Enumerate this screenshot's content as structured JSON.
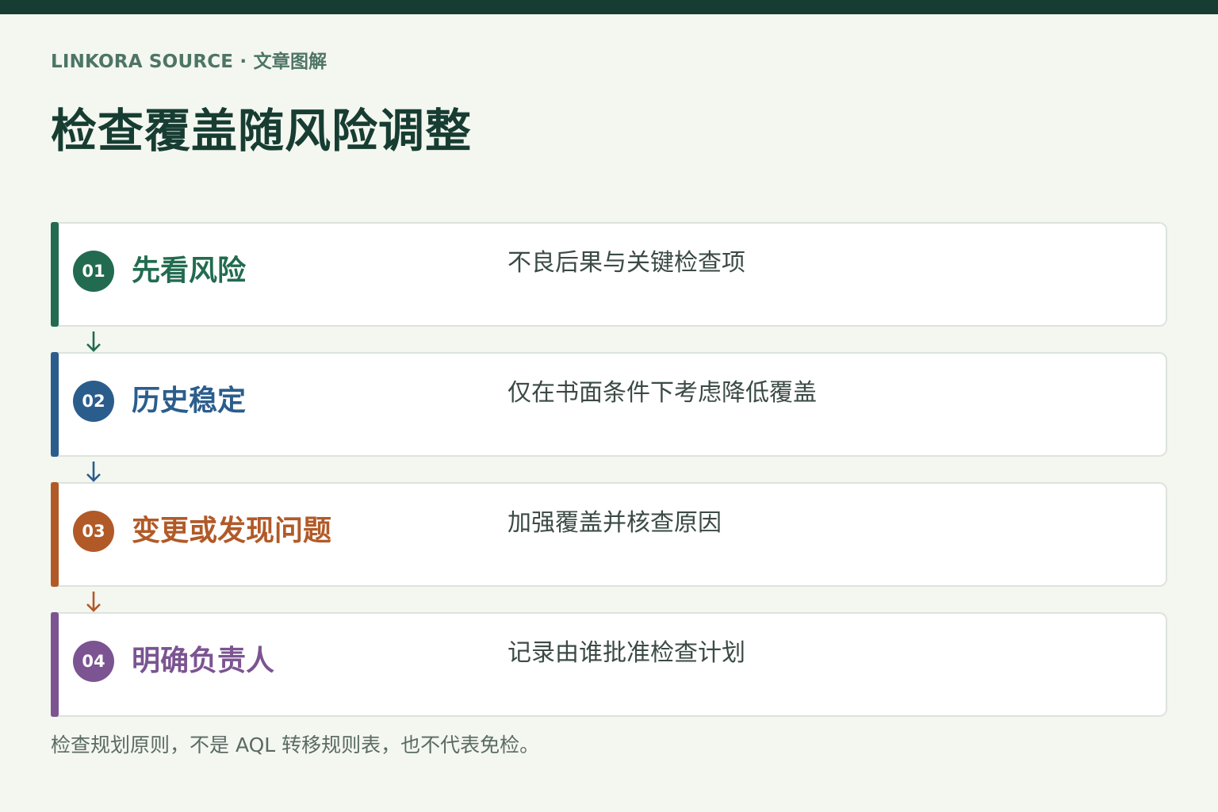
{
  "header": {
    "kicker": "LINKORA SOURCE · 文章图解",
    "title": "检查覆盖随风险调整"
  },
  "steps": [
    {
      "number": "01",
      "title": "先看风险",
      "description": "不良后果与关键检查项",
      "color": "#226b51"
    },
    {
      "number": "02",
      "title": "历史稳定",
      "description": "仅在书面条件下考虑降低覆盖",
      "color": "#2b5d8c"
    },
    {
      "number": "03",
      "title": "变更或发现问题",
      "description": "加强覆盖并核查原因",
      "color": "#b15a28"
    },
    {
      "number": "04",
      "title": "明确负责人",
      "description": "记录由谁批准检查计划",
      "color": "#7b5491"
    }
  ],
  "footnote": "检查规划原则，不是 AQL 转移规则表，也不代表免检。",
  "colors": {
    "top_bar": "#173d32",
    "background": "#f4f6f0",
    "title": "#173d32"
  }
}
